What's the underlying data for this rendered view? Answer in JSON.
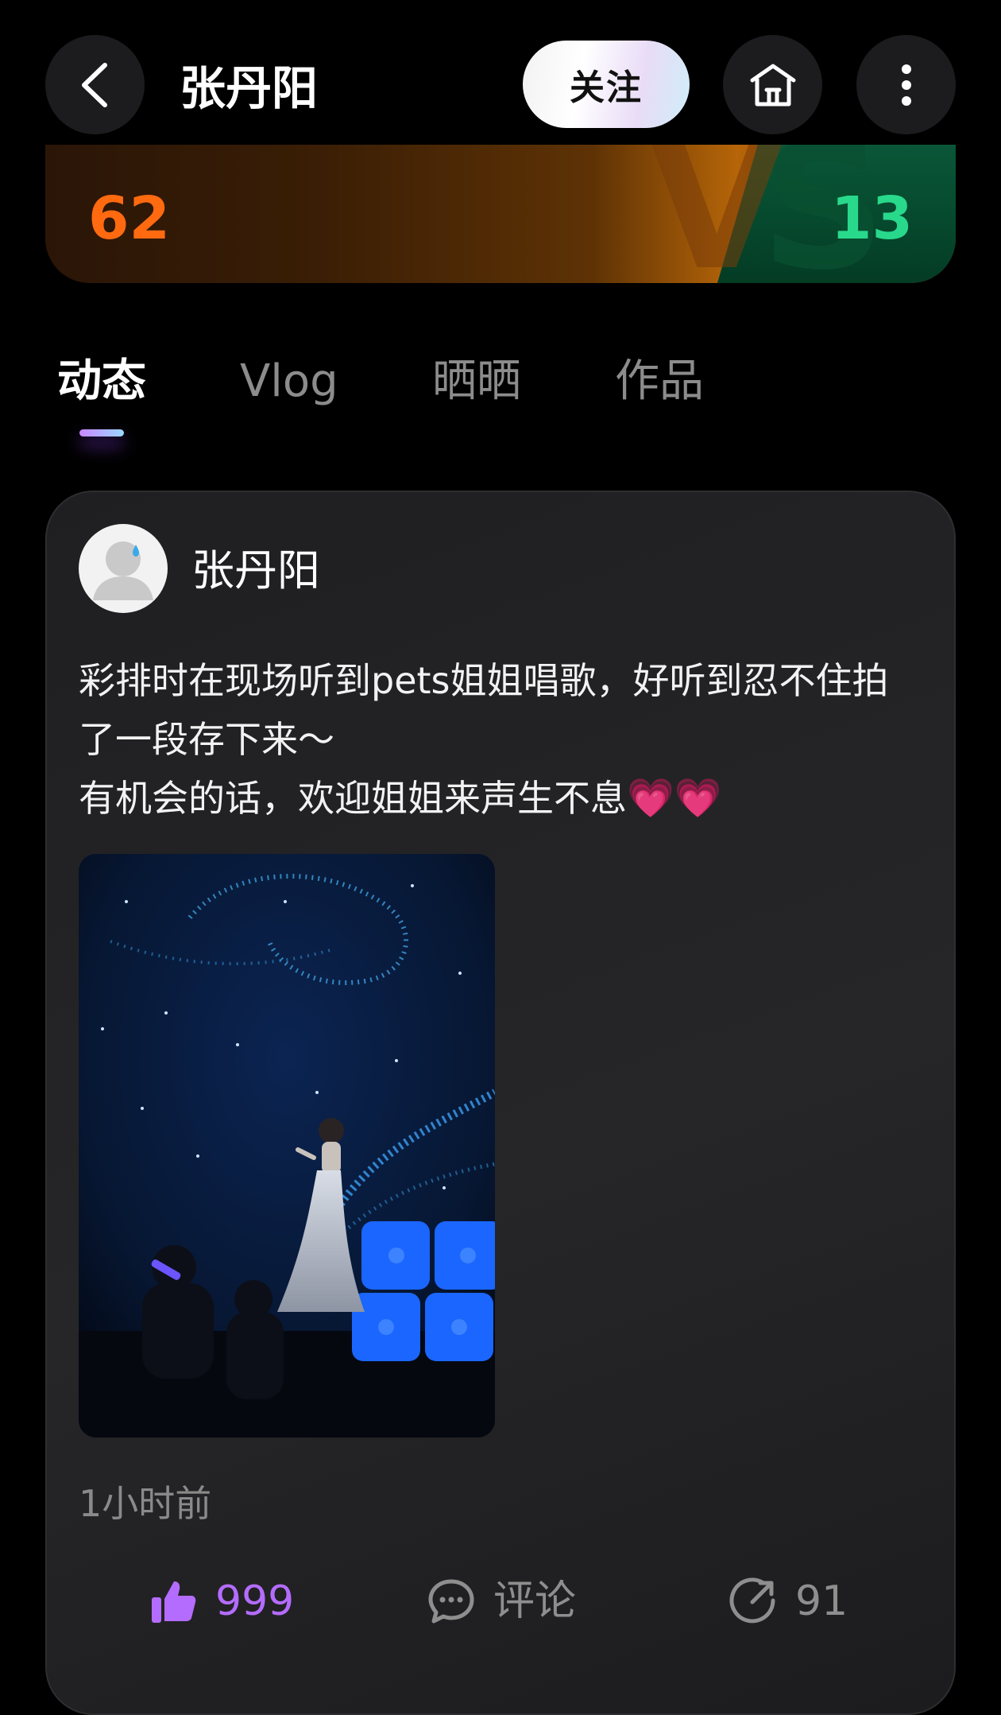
{
  "header": {
    "title": "张丹阳",
    "follow_label": "关注"
  },
  "vs_banner": {
    "left_score": "62",
    "right_score": "13",
    "vs_text": "VS"
  },
  "tabs": [
    {
      "label": "动态",
      "active": true
    },
    {
      "label": "Vlog",
      "active": false
    },
    {
      "label": "晒晒",
      "active": false
    },
    {
      "label": "作品",
      "active": false
    }
  ],
  "post": {
    "author": "张丹阳",
    "text_line1": "彩排时在现场听到pets姐姐唱歌，好听到忍不住拍了一段存下来～",
    "text_line2": "有机会的话，欢迎姐姐来声生不息",
    "text_emoji": "💗💗",
    "time": "1小时前",
    "likes": "999",
    "comment_label": "评论",
    "shares": "91"
  },
  "colors": {
    "accent_like": "#b46cff",
    "score_left": "#ff6a10",
    "score_right": "#28d98b",
    "heart": "#ff3a7f"
  },
  "icons": [
    "back-icon",
    "home-icon",
    "more-icon",
    "thumbs-up-icon",
    "comment-icon",
    "share-icon"
  ]
}
